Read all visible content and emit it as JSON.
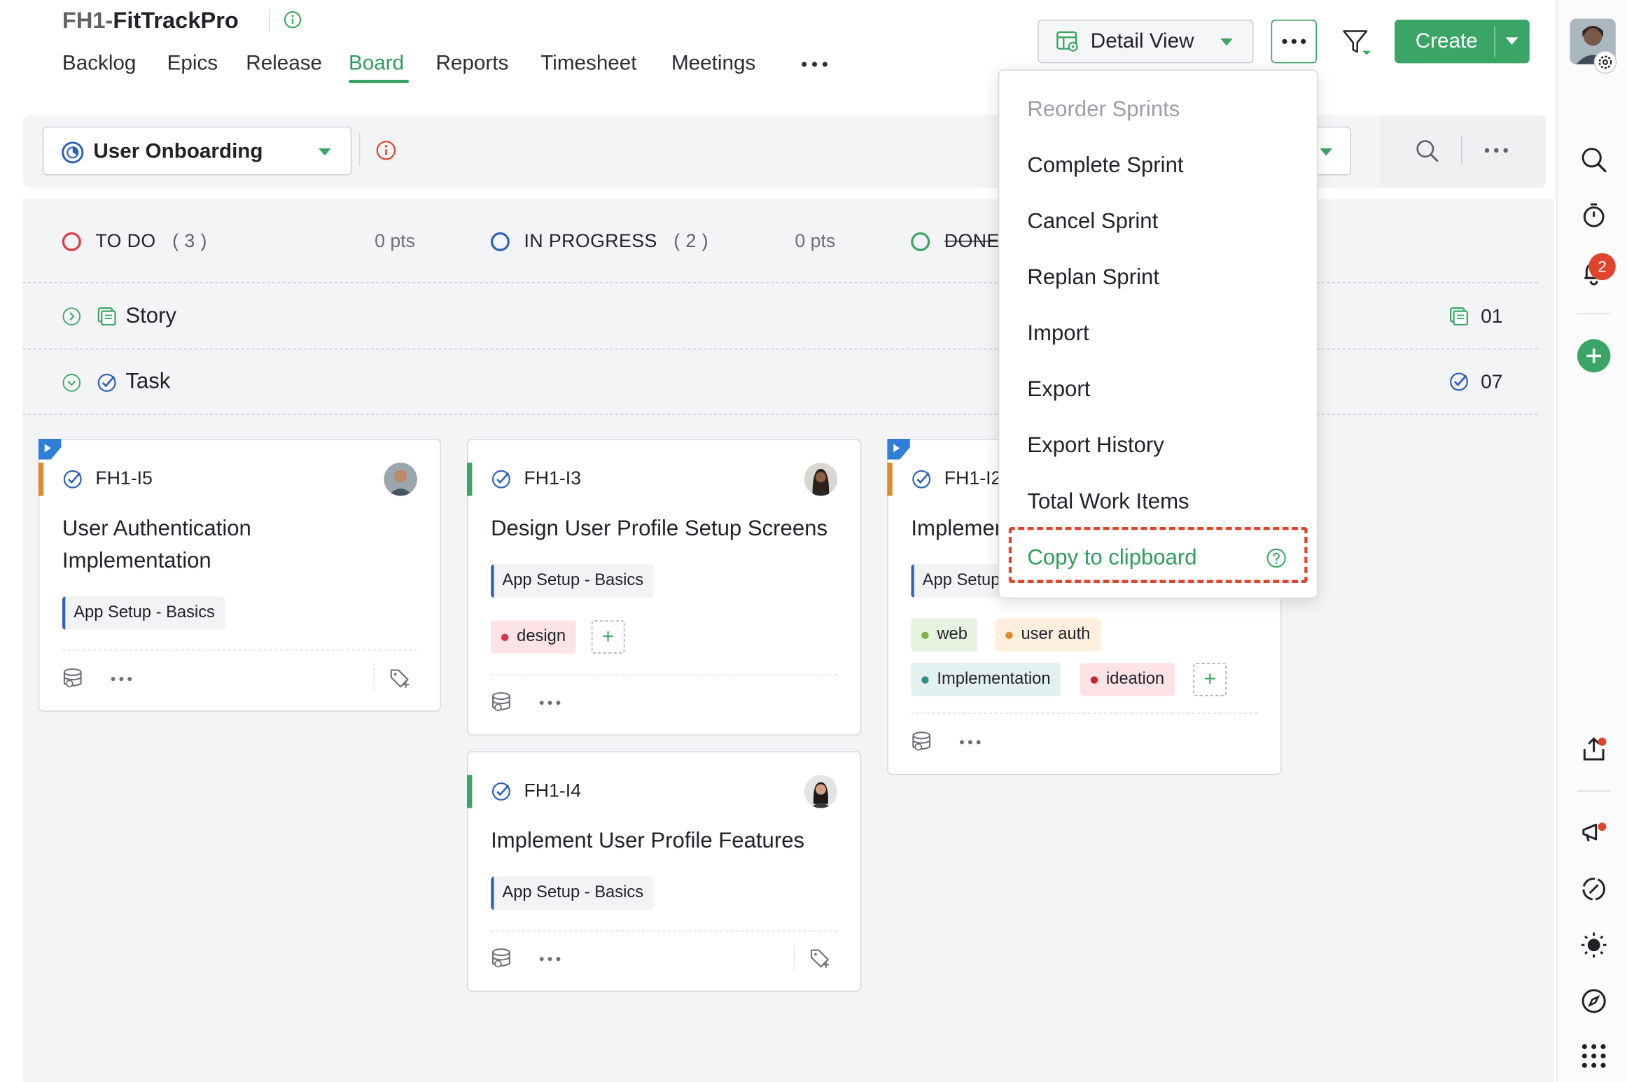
{
  "project": {
    "prefix": "FH1-",
    "name": "FitTrackPro"
  },
  "nav": {
    "items": [
      "Backlog",
      "Epics",
      "Release",
      "Board",
      "Reports",
      "Timesheet",
      "Meetings"
    ],
    "active": "Board"
  },
  "header": {
    "view_label": "Detail View",
    "create_label": "Create"
  },
  "toolbar": {
    "sprint_name": "User Onboarding"
  },
  "columns": [
    {
      "name": "TO DO",
      "count": "( 3 )",
      "pts": "0 pts"
    },
    {
      "name": "IN PROGRESS",
      "count": "( 2 )",
      "pts": "0 pts"
    },
    {
      "name": "DONE"
    }
  ],
  "swimlanes": [
    {
      "label": "Story",
      "count": "01"
    },
    {
      "label": "Task",
      "count": "07"
    }
  ],
  "cards": [
    {
      "id": "FH1-I5",
      "title_line1": "User Authentication",
      "title_line2": "Implementation",
      "epic": "App Setup - Basics"
    },
    {
      "id": "FH1-I3",
      "title": "Design User Profile Setup Screens",
      "epic": "App Setup - Basics",
      "tags": [
        "design"
      ]
    },
    {
      "id": "FH1-I4",
      "title": "Implement User Profile Features",
      "epic": "App Setup - Basics"
    },
    {
      "id": "FH1-I2",
      "title": "Implement",
      "epic": "App Setup",
      "tags": [
        "web",
        "user auth",
        "Implementation",
        "ideation"
      ]
    }
  ],
  "menu": {
    "items": [
      "Reorder Sprints",
      "Complete Sprint",
      "Cancel Sprint",
      "Replan Sprint",
      "Import",
      "Export",
      "Export History",
      "Total Work Items",
      "Copy to clipboard"
    ],
    "disabled": [
      "Reorder Sprints"
    ],
    "highlighted": "Copy to clipboard"
  },
  "notifications": {
    "count": "2"
  },
  "colors": {
    "accent": "#2e9d5b",
    "todo": "#e0394a",
    "inprogress": "#2f62b8",
    "done": "#3aa565",
    "highlight": "#e0452c"
  }
}
